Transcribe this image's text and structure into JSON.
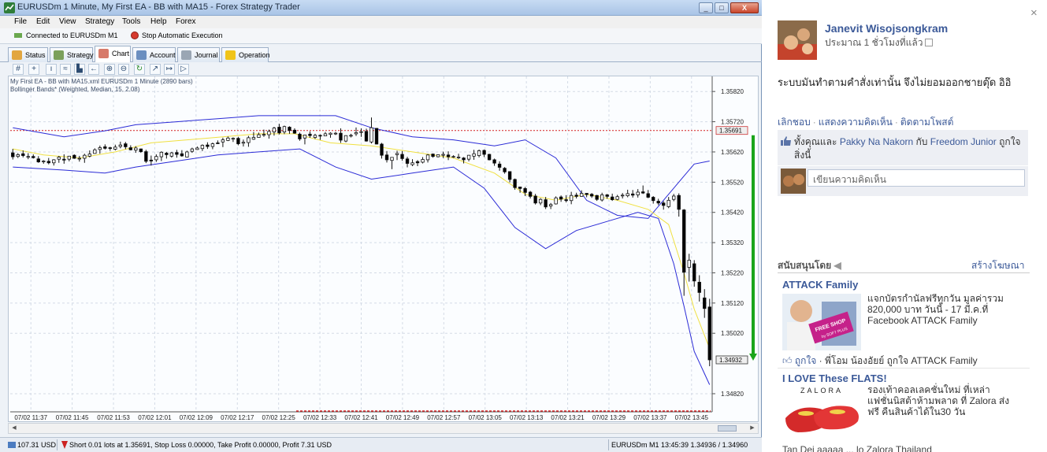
{
  "window": {
    "title": "EURUSDm 1 Minute, My First EA - BB with MA15 - Forex Strategy Trader",
    "controls": [
      "_",
      "□",
      "X"
    ]
  },
  "menu": [
    "File",
    "Edit",
    "View",
    "Strategy",
    "Tools",
    "Help",
    "Forex"
  ],
  "connection": {
    "status": "Connected to EURUSDm M1",
    "stop_label": "Stop Automatic Execution"
  },
  "tabs": [
    {
      "label": "Status",
      "icon": "status-icon"
    },
    {
      "label": "Strategy",
      "icon": "strategy-icon"
    },
    {
      "label": "Chart",
      "icon": "chart-icon",
      "active": true
    },
    {
      "label": "Account",
      "icon": "account-icon"
    },
    {
      "label": "Journal",
      "icon": "journal-icon"
    },
    {
      "label": "Operation",
      "icon": "operation-icon"
    }
  ],
  "chart_tools": [
    "grid-icon",
    "crosshair-icon",
    "volume-icon",
    "orders-icon",
    "positions-icon",
    "indicators-icon",
    "zoom-in-icon",
    "zoom-out-icon",
    "refresh-icon",
    "trade-icon",
    "entry-icon",
    "auto-scroll-icon"
  ],
  "chart_info": {
    "line1": "My First EA - BB with MA15.xml EURUSDm 1 Minute (2890 bars)",
    "line2": "Bollinger Bands* (Weighted, Median, 15, 2.08)"
  },
  "chart_data": {
    "type": "candlestick",
    "y_ticks": [
      "1.35820",
      "1.35720",
      "1.35620",
      "1.35520",
      "1.35420",
      "1.35320",
      "1.35220",
      "1.35120",
      "1.35020",
      "1.34820"
    ],
    "ylim": [
      1.3476,
      1.3587
    ],
    "x_ticks": [
      "07/02 11:37",
      "07/02 11:45",
      "07/02 11:53",
      "07/02 12:01",
      "07/02 12:09",
      "07/02 12:17",
      "07/02 12:25",
      "07/02 12:33",
      "07/02 12:41",
      "07/02 12:49",
      "07/02 12:57",
      "07/02 13:05",
      "07/02 13:13",
      "07/02 13:21",
      "07/02 13:29",
      "07/02 13:37",
      "07/02 13:45"
    ],
    "price_labels": {
      "entry": "1.35691",
      "current": "1.34932"
    },
    "entry_price": 1.35691,
    "current_price": 1.34932,
    "grid": true,
    "colors": {
      "bull": "#ffffff",
      "bear": "#000000",
      "bands": "#2b2bd6",
      "ma": "#f0e040",
      "entry": "#d32020",
      "arrow": "#1aa51a"
    },
    "trend_points": [
      [
        0,
        1.3563
      ],
      [
        6,
        1.3561
      ],
      [
        13,
        1.356
      ],
      [
        20,
        1.3562
      ],
      [
        27,
        1.3565
      ],
      [
        34,
        1.3566
      ],
      [
        41,
        1.3567
      ],
      [
        48,
        1.3568
      ],
      [
        55,
        1.3568
      ],
      [
        62,
        1.3565
      ],
      [
        70,
        1.3564
      ],
      [
        78,
        1.3562
      ],
      [
        86,
        1.356
      ],
      [
        94,
        1.3555
      ],
      [
        100,
        1.3548
      ],
      [
        106,
        1.3546
      ],
      [
        112,
        1.3548
      ],
      [
        118,
        1.3546
      ],
      [
        124,
        1.3543
      ],
      [
        128,
        1.3538
      ],
      [
        131,
        1.3522
      ],
      [
        133,
        1.351
      ],
      [
        136,
        1.3497
      ]
    ],
    "upper_band": [
      [
        0,
        1.357
      ],
      [
        10,
        1.3567
      ],
      [
        18,
        1.3569
      ],
      [
        24,
        1.3571
      ],
      [
        32,
        1.3572
      ],
      [
        40,
        1.3573
      ],
      [
        48,
        1.3574
      ],
      [
        56,
        1.3574
      ],
      [
        63,
        1.3574
      ],
      [
        70,
        1.357
      ],
      [
        78,
        1.3567
      ],
      [
        86,
        1.3566
      ],
      [
        94,
        1.3564
      ],
      [
        100,
        1.3566
      ],
      [
        106,
        1.356
      ],
      [
        112,
        1.3546
      ],
      [
        118,
        1.3541
      ],
      [
        124,
        1.354
      ],
      [
        128,
        1.3548
      ],
      [
        131,
        1.3554
      ],
      [
        133,
        1.3558
      ],
      [
        136,
        1.3559
      ]
    ],
    "lower_band": [
      [
        0,
        1.3557
      ],
      [
        10,
        1.3556
      ],
      [
        18,
        1.3555
      ],
      [
        24,
        1.3557
      ],
      [
        32,
        1.3559
      ],
      [
        40,
        1.3561
      ],
      [
        48,
        1.3562
      ],
      [
        56,
        1.3563
      ],
      [
        63,
        1.3557
      ],
      [
        70,
        1.3553
      ],
      [
        78,
        1.3555
      ],
      [
        86,
        1.3557
      ],
      [
        92,
        1.355
      ],
      [
        98,
        1.3537
      ],
      [
        104,
        1.353
      ],
      [
        110,
        1.3536
      ],
      [
        116,
        1.3539
      ],
      [
        122,
        1.3542
      ],
      [
        126,
        1.354
      ],
      [
        129,
        1.3525
      ],
      [
        131,
        1.3511
      ],
      [
        133,
        1.3496
      ],
      [
        136,
        1.3485
      ]
    ],
    "candles": [
      [
        1.35617,
        1.3563,
        1.35595,
        1.35604
      ],
      [
        1.35605,
        1.35616,
        1.356,
        1.35611
      ],
      [
        1.35614,
        1.35625,
        1.35602,
        1.35608
      ],
      [
        1.35604,
        1.35616,
        1.35596,
        1.35605
      ],
      [
        1.35605,
        1.35612,
        1.35598,
        1.35601
      ],
      [
        1.35597,
        1.35606,
        1.35584,
        1.35587
      ],
      [
        1.35589,
        1.35593,
        1.35581,
        1.3559
      ],
      [
        1.35589,
        1.356,
        1.35579,
        1.35584
      ],
      [
        1.35584,
        1.35596,
        1.35575,
        1.35594
      ],
      [
        1.35596,
        1.35607,
        1.35584,
        1.35603
      ],
      [
        1.35596,
        1.35612,
        1.35581,
        1.35593
      ],
      [
        1.35596,
        1.35607,
        1.35589,
        1.35606
      ],
      [
        1.35609,
        1.35612,
        1.35597,
        1.35599
      ],
      [
        1.35598,
        1.35607,
        1.35588,
        1.35599
      ],
      [
        1.35599,
        1.35614,
        1.35584,
        1.35609
      ],
      [
        1.35606,
        1.35625,
        1.35602,
        1.35613
      ],
      [
        1.35615,
        1.35632,
        1.35614,
        1.35627
      ],
      [
        1.35628,
        1.35641,
        1.35614,
        1.35634
      ],
      [
        1.35637,
        1.35645,
        1.35628,
        1.35632
      ],
      [
        1.35634,
        1.35637,
        1.35624,
        1.35632
      ],
      [
        1.35629,
        1.35644,
        1.35625,
        1.35636
      ],
      [
        1.35638,
        1.35654,
        1.35632,
        1.35643
      ],
      [
        1.35647,
        1.35653,
        1.35629,
        1.35637
      ],
      [
        1.35634,
        1.35642,
        1.35625,
        1.35627
      ],
      [
        1.35626,
        1.35639,
        1.35617,
        1.35633
      ],
      [
        1.3563,
        1.35631,
        1.35617,
        1.35621
      ],
      [
        1.35621,
        1.35627,
        1.35583,
        1.35589
      ],
      [
        1.35593,
        1.35608,
        1.35575,
        1.3559
      ],
      [
        1.35594,
        1.35612,
        1.35587,
        1.35605
      ],
      [
        1.35604,
        1.35622,
        1.3559,
        1.35619
      ],
      [
        1.35616,
        1.3562,
        1.35598,
        1.35611
      ],
      [
        1.35606,
        1.3562,
        1.35601,
        1.35617
      ],
      [
        1.35618,
        1.35627,
        1.35601,
        1.35612
      ],
      [
        1.35614,
        1.35626,
        1.35604,
        1.35607
      ],
      [
        1.35603,
        1.35624,
        1.35602,
        1.3562
      ],
      [
        1.35622,
        1.35634,
        1.35617,
        1.3563
      ],
      [
        1.35628,
        1.35638,
        1.35627,
        1.35633
      ],
      [
        1.35631,
        1.35645,
        1.35623,
        1.35642
      ],
      [
        1.35643,
        1.35652,
        1.3563,
        1.35638
      ],
      [
        1.35638,
        1.35651,
        1.35629,
        1.35647
      ],
      [
        1.3565,
        1.35658,
        1.35646,
        1.35649
      ],
      [
        1.35653,
        1.35667,
        1.35636,
        1.3566
      ],
      [
        1.35658,
        1.35671,
        1.35656,
        1.35666
      ],
      [
        1.35665,
        1.35668,
        1.35653,
        1.35665
      ],
      [
        1.35665,
        1.3567,
        1.35642,
        1.35647
      ],
      [
        1.35649,
        1.35661,
        1.35638,
        1.35652
      ],
      [
        1.35651,
        1.35673,
        1.35637,
        1.35667
      ],
      [
        1.35662,
        1.35686,
        1.3566,
        1.35668
      ],
      [
        1.35668,
        1.35684,
        1.35667,
        1.35677
      ],
      [
        1.35678,
        1.35694,
        1.3567,
        1.35678
      ],
      [
        1.35677,
        1.35694,
        1.35664,
        1.35688
      ],
      [
        1.35686,
        1.35703,
        1.35674,
        1.35699
      ],
      [
        1.35702,
        1.35713,
        1.35678,
        1.35683
      ],
      [
        1.35686,
        1.35707,
        1.35679,
        1.35704
      ],
      [
        1.35702,
        1.35705,
        1.3568,
        1.35691
      ],
      [
        1.35692,
        1.35698,
        1.3568,
        1.35682
      ],
      [
        1.35679,
        1.35684,
        1.35657,
        1.35663
      ],
      [
        1.35666,
        1.35677,
        1.35645,
        1.35676
      ],
      [
        1.35679,
        1.35688,
        1.35667,
        1.35674
      ],
      [
        1.35668,
        1.3568,
        1.35663,
        1.35675
      ],
      [
        1.35675,
        1.35678,
        1.3566,
        1.35673
      ],
      [
        1.35673,
        1.35686,
        1.35673,
        1.3568
      ],
      [
        1.35678,
        1.35685,
        1.35667,
        1.35682
      ],
      [
        1.35681,
        1.35686,
        1.35676,
        1.35682
      ],
      [
        1.35682,
        1.35698,
        1.3565,
        1.35659
      ],
      [
        1.35656,
        1.35675,
        1.35652,
        1.35674
      ],
      [
        1.35674,
        1.3568,
        1.35668,
        1.35675
      ],
      [
        1.3568,
        1.35701,
        1.35673,
        1.35684
      ],
      [
        1.35686,
        1.35698,
        1.3567,
        1.35687
      ],
      [
        1.35688,
        1.35697,
        1.35654,
        1.35656
      ],
      [
        1.35653,
        1.35734,
        1.35648,
        1.357
      ],
      [
        1.35698,
        1.35699,
        1.35645,
        1.35646
      ],
      [
        1.35646,
        1.3565,
        1.35598,
        1.35609
      ],
      [
        1.3561,
        1.35623,
        1.35585,
        1.35594
      ],
      [
        1.35592,
        1.35601,
        1.35563,
        1.35602
      ],
      [
        1.35611,
        1.35624,
        1.35593,
        1.35615
      ],
      [
        1.35612,
        1.35623,
        1.35591,
        1.35598
      ],
      [
        1.35597,
        1.35604,
        1.35569,
        1.35582
      ],
      [
        1.35578,
        1.35596,
        1.35573,
        1.35584
      ],
      [
        1.35588,
        1.35593,
        1.35573,
        1.35584
      ],
      [
        1.35586,
        1.35603,
        1.35582,
        1.35595
      ],
      [
        1.35594,
        1.35613,
        1.35585,
        1.3561
      ],
      [
        1.35613,
        1.35615,
        1.35601,
        1.35605
      ],
      [
        1.35604,
        1.35612,
        1.35602,
        1.35611
      ],
      [
        1.35609,
        1.35621,
        1.356,
        1.35612
      ],
      [
        1.3561,
        1.35622,
        1.35593,
        1.35604
      ],
      [
        1.35604,
        1.35609,
        1.356,
        1.35605
      ],
      [
        1.35603,
        1.35614,
        1.35597,
        1.35603
      ],
      [
        1.356,
        1.35603,
        1.35582,
        1.35594
      ],
      [
        1.35596,
        1.3561,
        1.35589,
        1.35609
      ],
      [
        1.35606,
        1.35627,
        1.35594,
        1.35614
      ],
      [
        1.35608,
        1.35628,
        1.35602,
        1.35624
      ],
      [
        1.35625,
        1.35628,
        1.35603,
        1.35612
      ],
      [
        1.35612,
        1.35614,
        1.35592,
        1.35594
      ],
      [
        1.35594,
        1.35598,
        1.35574,
        1.35583
      ],
      [
        1.3558,
        1.35589,
        1.35558,
        1.35569
      ],
      [
        1.35566,
        1.3557,
        1.35548,
        1.35554
      ],
      [
        1.35555,
        1.35556,
        1.35519,
        1.35529
      ],
      [
        1.35529,
        1.35532,
        1.35495,
        1.35502
      ],
      [
        1.35504,
        1.35505,
        1.35485,
        1.35499
      ],
      [
        1.35499,
        1.35504,
        1.35474,
        1.35486
      ],
      [
        1.35487,
        1.35491,
        1.35466,
        1.35473
      ],
      [
        1.35474,
        1.35481,
        1.35446,
        1.35451
      ],
      [
        1.35451,
        1.35467,
        1.35444,
        1.35463
      ],
      [
        1.35462,
        1.35471,
        1.35431,
        1.35438
      ],
      [
        1.35441,
        1.35451,
        1.35431,
        1.35446
      ],
      [
        1.35448,
        1.35473,
        1.35446,
        1.35468
      ],
      [
        1.35471,
        1.35476,
        1.35455,
        1.35464
      ],
      [
        1.35462,
        1.35477,
        1.35453,
        1.35459
      ],
      [
        1.35459,
        1.35488,
        1.35447,
        1.35476
      ],
      [
        1.35477,
        1.35485,
        1.35466,
        1.35473
      ],
      [
        1.35473,
        1.35493,
        1.35472,
        1.35483
      ],
      [
        1.35483,
        1.35484,
        1.3547,
        1.35479
      ],
      [
        1.3548,
        1.35484,
        1.35468,
        1.35474
      ],
      [
        1.35476,
        1.35478,
        1.35458,
        1.35463
      ],
      [
        1.35461,
        1.35485,
        1.35456,
        1.35478
      ],
      [
        1.35478,
        1.35481,
        1.35465,
        1.35473
      ],
      [
        1.35471,
        1.35482,
        1.35458,
        1.35462
      ],
      [
        1.35463,
        1.35478,
        1.3546,
        1.35472
      ],
      [
        1.35476,
        1.35484,
        1.35466,
        1.35477
      ],
      [
        1.35475,
        1.35495,
        1.3547,
        1.35482
      ],
      [
        1.35481,
        1.35494,
        1.35469,
        1.35477
      ],
      [
        1.35478,
        1.35497,
        1.35469,
        1.35487
      ],
      [
        1.35488,
        1.35509,
        1.35481,
        1.35484
      ],
      [
        1.35482,
        1.35494,
        1.35467,
        1.3547
      ],
      [
        1.3547,
        1.35474,
        1.35449,
        1.35459
      ],
      [
        1.35457,
        1.35465,
        1.35444,
        1.35451
      ],
      [
        1.35451,
        1.35457,
        1.35429,
        1.35443
      ],
      [
        1.35439,
        1.35471,
        1.35434,
        1.3546
      ],
      [
        1.35463,
        1.35481,
        1.35457,
        1.35474
      ],
      [
        1.35476,
        1.35483,
        1.35406,
        1.3543
      ],
      [
        1.35428,
        1.35431,
        1.35144,
        1.35222
      ],
      [
        1.35238,
        1.35283,
        1.35191,
        1.35262
      ],
      [
        1.3525,
        1.35262,
        1.35174,
        1.35193
      ],
      [
        1.35189,
        1.35212,
        1.35125,
        1.35155
      ],
      [
        1.35137,
        1.35166,
        1.35071,
        1.35102
      ],
      [
        1.35107,
        1.35134,
        1.34911,
        1.34932
      ]
    ]
  },
  "statusbar": {
    "balance": "107.31 USD",
    "position": "Short 0.01 lots at 1.35691, Stop Loss 0.00000, Take Profit 0.00000, Profit 7.31 USD",
    "quote": "EURUSDm M1   13:45:39 1.34936 / 1.34960"
  },
  "facebook": {
    "close": "×",
    "user_name": "Janevit Wisojsongkram",
    "time_ago": "ประมาณ 1 ชั่วโมงที่แล้ว",
    "message": "ระบบมันทำตามคำสั่งเท่านั้น จึงไม่ยอมออกชายตุ๊ด อิอิ",
    "actions": [
      "เลิกชอบ",
      "แสดงความคิดเห็น",
      "ติดตามโพสต์"
    ],
    "likes_prefix": "ทั้งคุณและ",
    "likes_name1": "Pakky Na Nakorn",
    "likes_and": "กับ",
    "likes_name2": "Freedom Junior",
    "likes_suffix": "ถูกใจสิ่งนี้",
    "comment_placeholder": "เขียนความคิดเห็น",
    "sponsored": "สนับสนุนโดย",
    "create_ad": "สร้างโฆษณา",
    "ads": [
      {
        "title": "ATTACK Family",
        "text": "แจกบัตรกำนัลฟรีทุกวัน มูลค่ารวม 820,000 บาท วันนี้ - 17 มี.ค.ที่ Facebook ATTACK Family",
        "image_text1": "FREE SHOP",
        "image_text2": "by SOFT PLUS",
        "like_label": "ถูกใจ",
        "like_social": "· พี่โอม น้องอัยย์ ถูกใจ ATTACK Family"
      },
      {
        "title": "I LOVE These FLATS!",
        "text": "รองเท้าคอลเลคชั่นใหม่ ที่เหล่าแฟชั่นนิสต้าห้ามพลาด ที่ Zalora ส่งฟรี คืนสินค้าได้ใน30 วัน",
        "image_text1": "ZALORA"
      }
    ],
    "cut_text": "Tan Dei aaaaa ... lo Zalora Thailand"
  }
}
